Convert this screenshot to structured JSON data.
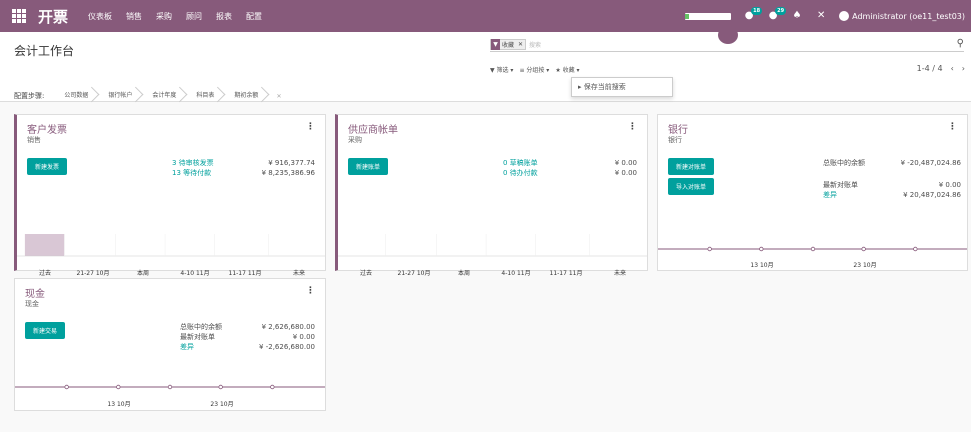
{
  "nav": {
    "brand": "开票",
    "menu": [
      "仪表板",
      "销售",
      "采购",
      "顾问",
      "报表",
      "配置"
    ],
    "messages_count": "18",
    "activity_count": "29",
    "user": "Administrator (oe11_test03)"
  },
  "page": {
    "title": "会计工作台"
  },
  "search": {
    "facet_label": "收藏",
    "placeholder": "搜索",
    "filters_label": "▼ 筛选 ▾",
    "groupby_label": "≡ 分组按 ▾",
    "favorites_label": "★ 收藏 ▾",
    "pager": "1-4 / 4",
    "dropdown_item": "▸ 保存当前搜索"
  },
  "steps": {
    "label": "配置步骤:",
    "items": [
      "公司数据",
      "银行帐户",
      "会计年度",
      "科目表",
      "期初余额"
    ]
  },
  "cards": [
    {
      "title": "客户发票",
      "subtitle": "销售",
      "buttons": [
        "新建发票"
      ],
      "stats": [
        {
          "label": "3 待审核发票",
          "value": "¥ 916,377.74"
        },
        {
          "label": "13 等待付款",
          "value": "¥ 8,235,386.96"
        }
      ],
      "bars": [
        "过去",
        "21-27 10月",
        "本周",
        "4-10 11月",
        "11-17 11月",
        "未来"
      ]
    },
    {
      "title": "供应商帐单",
      "subtitle": "采购",
      "buttons": [
        "新建账单"
      ],
      "stats": [
        {
          "label": "0 草稿账单",
          "value": "¥ 0.00"
        },
        {
          "label": "0 待办付款",
          "value": "¥ 0.00"
        }
      ],
      "bars": [
        "过去",
        "21-27 10月",
        "本周",
        "4-10 11月",
        "11-17 11月",
        "未来"
      ]
    },
    {
      "title": "银行",
      "subtitle": "银行",
      "buttons": [
        "新建对账单",
        "导入对账单"
      ],
      "stats": [
        {
          "label": "总账中的余额",
          "value": "¥ -20,487,024.86"
        },
        {
          "label": "最新对账单",
          "value": "¥ 0.00"
        },
        {
          "label": "差异",
          "value": "¥ 20,487,024.86"
        }
      ],
      "dates": [
        "13 10月",
        "23 10月"
      ]
    },
    {
      "title": "现金",
      "subtitle": "现金",
      "buttons": [
        "新建交易"
      ],
      "stats": [
        {
          "label": "总账中的余额",
          "value": "¥ 2,626,680.00"
        },
        {
          "label": "最新对账单",
          "value": "¥ 0.00"
        },
        {
          "label": "差异",
          "value": "¥ -2,626,680.00"
        }
      ],
      "dates": [
        "13 10月",
        "23 10月"
      ]
    }
  ],
  "colors": {
    "brand": "#875a7b",
    "accent": "#00a09d"
  }
}
